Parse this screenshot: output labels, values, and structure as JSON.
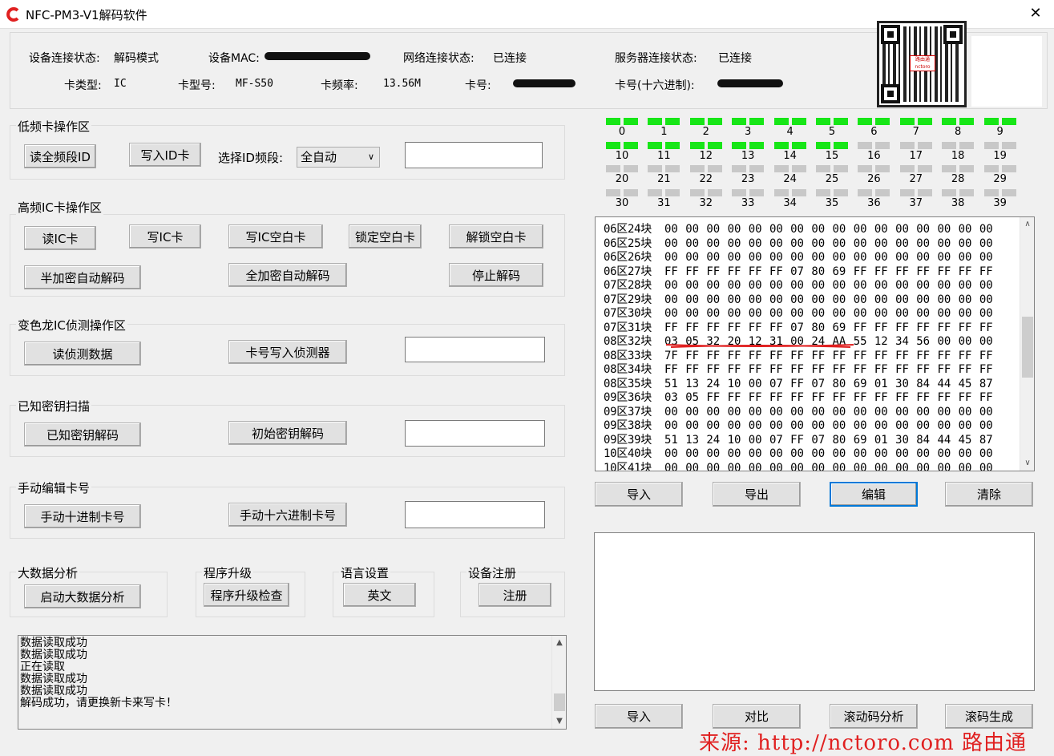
{
  "window": {
    "title": "NFC-PM3-V1解码软件",
    "close_glyph": "✕",
    "logo_color": "#e02020"
  },
  "status": {
    "device_state_label": "设备连接状态:",
    "device_state_value": "解码模式",
    "mac_label": "设备MAC:",
    "network_label": "网络连接状态:",
    "network_value": "已连接",
    "server_label": "服务器连接状态:",
    "server_value": "已连接",
    "card_type_label": "卡类型:",
    "card_type_value": "IC",
    "card_model_label": "卡型号:",
    "card_model_value": "MF-S50",
    "card_freq_label": "卡频率:",
    "card_freq_value": "13.56M",
    "card_no_label": "卡号:",
    "card_no_hex_label": "卡号(十六进制):"
  },
  "qr": {
    "badge_text": "路由通 nctoro"
  },
  "lf": {
    "title": "低频卡操作区",
    "read_all": "读全频段ID",
    "write_id": "写入ID卡",
    "select_label": "选择ID频段:",
    "select_value": "全自动"
  },
  "hf": {
    "title": "高频IC卡操作区",
    "read_ic": "读IC卡",
    "write_ic": "写IC卡",
    "write_blank": "写IC空白卡",
    "lock_blank": "锁定空白卡",
    "unlock_blank": "解锁空白卡",
    "half_decrypt": "半加密自动解码",
    "full_decrypt": "全加密自动解码",
    "stop_decrypt": "停止解码"
  },
  "chameleon": {
    "title": "变色龙IC侦测操作区",
    "read_detect": "读侦测数据",
    "write_detector": "卡号写入侦测器"
  },
  "known_keys": {
    "title": "已知密钥扫描",
    "known_decrypt": "已知密钥解码",
    "initial_decrypt": "初始密钥解码"
  },
  "manual": {
    "title": "手动编辑卡号",
    "dec_card": "手动十进制卡号",
    "hex_card": "手动十六进制卡号"
  },
  "bigdata": {
    "title": "大数据分析",
    "start": "启动大数据分析"
  },
  "upgrade": {
    "title": "程序升级",
    "check": "程序升级检查"
  },
  "language": {
    "title": "语言设置",
    "english": "英文"
  },
  "register": {
    "title": "设备注册",
    "register_btn": "注册"
  },
  "sectors": {
    "colors": {
      "ok": "#17e617",
      "empty": "#c8c8c8"
    },
    "rows": [
      {
        "labels": [
          "0",
          "1",
          "2",
          "3",
          "4",
          "5",
          "6",
          "7",
          "8",
          "9"
        ],
        "status": [
          "ok",
          "ok",
          "ok",
          "ok",
          "ok",
          "ok",
          "ok",
          "ok",
          "ok",
          "ok"
        ]
      },
      {
        "labels": [
          "10",
          "11",
          "12",
          "13",
          "14",
          "15",
          "16",
          "17",
          "18",
          "19"
        ],
        "status": [
          "ok",
          "ok",
          "ok",
          "ok",
          "ok",
          "ok",
          "empty",
          "empty",
          "empty",
          "empty"
        ]
      },
      {
        "labels": [
          "20",
          "21",
          "22",
          "23",
          "24",
          "25",
          "26",
          "27",
          "28",
          "29"
        ],
        "status": [
          "empty",
          "empty",
          "empty",
          "empty",
          "empty",
          "empty",
          "empty",
          "empty",
          "empty",
          "empty"
        ]
      },
      {
        "labels": [
          "30",
          "31",
          "32",
          "33",
          "34",
          "35",
          "36",
          "37",
          "38",
          "39"
        ],
        "status": [
          "empty",
          "empty",
          "empty",
          "empty",
          "empty",
          "empty",
          "empty",
          "empty",
          "empty",
          "empty"
        ]
      }
    ]
  },
  "hexdump": {
    "rows": [
      {
        "prefix": "06区24块",
        "bytes": [
          "00",
          "00",
          "00",
          "00",
          "00",
          "00",
          "00",
          "00",
          "00",
          "00",
          "00",
          "00",
          "00",
          "00",
          "00",
          "00"
        ]
      },
      {
        "prefix": "06区25块",
        "bytes": [
          "00",
          "00",
          "00",
          "00",
          "00",
          "00",
          "00",
          "00",
          "00",
          "00",
          "00",
          "00",
          "00",
          "00",
          "00",
          "00"
        ]
      },
      {
        "prefix": "06区26块",
        "bytes": [
          "00",
          "00",
          "00",
          "00",
          "00",
          "00",
          "00",
          "00",
          "00",
          "00",
          "00",
          "00",
          "00",
          "00",
          "00",
          "00"
        ]
      },
      {
        "prefix": "06区27块",
        "bytes": [
          "FF",
          "FF",
          "FF",
          "FF",
          "FF",
          "FF",
          "07",
          "80",
          "69",
          "FF",
          "FF",
          "FF",
          "FF",
          "FF",
          "FF",
          "FF"
        ]
      },
      {
        "prefix": "07区28块",
        "bytes": [
          "00",
          "00",
          "00",
          "00",
          "00",
          "00",
          "00",
          "00",
          "00",
          "00",
          "00",
          "00",
          "00",
          "00",
          "00",
          "00"
        ]
      },
      {
        "prefix": "07区29块",
        "bytes": [
          "00",
          "00",
          "00",
          "00",
          "00",
          "00",
          "00",
          "00",
          "00",
          "00",
          "00",
          "00",
          "00",
          "00",
          "00",
          "00"
        ]
      },
      {
        "prefix": "07区30块",
        "bytes": [
          "00",
          "00",
          "00",
          "00",
          "00",
          "00",
          "00",
          "00",
          "00",
          "00",
          "00",
          "00",
          "00",
          "00",
          "00",
          "00"
        ]
      },
      {
        "prefix": "07区31块",
        "bytes": [
          "FF",
          "FF",
          "FF",
          "FF",
          "FF",
          "FF",
          "07",
          "80",
          "69",
          "FF",
          "FF",
          "FF",
          "FF",
          "FF",
          "FF",
          "FF"
        ]
      },
      {
        "prefix": "08区32块",
        "bytes": [
          "03",
          "05",
          "32",
          "20",
          "12",
          "31",
          "00",
          "24",
          "AA",
          "55",
          "12",
          "34",
          "56",
          "00",
          "00",
          "00"
        ]
      },
      {
        "prefix": "08区33块",
        "bytes": [
          "7F",
          "FF",
          "FF",
          "FF",
          "FF",
          "FF",
          "FF",
          "FF",
          "FF",
          "FF",
          "FF",
          "FF",
          "FF",
          "FF",
          "FF",
          "FF"
        ]
      },
      {
        "prefix": "08区34块",
        "bytes": [
          "FF",
          "FF",
          "FF",
          "FF",
          "FF",
          "FF",
          "FF",
          "FF",
          "FF",
          "FF",
          "FF",
          "FF",
          "FF",
          "FF",
          "FF",
          "FF"
        ]
      },
      {
        "prefix": "08区35块",
        "bytes": [
          "51",
          "13",
          "24",
          "10",
          "00",
          "07",
          "FF",
          "07",
          "80",
          "69",
          "01",
          "30",
          "84",
          "44",
          "45",
          "87"
        ]
      },
      {
        "prefix": "09区36块",
        "bytes": [
          "03",
          "05",
          "FF",
          "FF",
          "FF",
          "FF",
          "FF",
          "FF",
          "FF",
          "FF",
          "FF",
          "FF",
          "FF",
          "FF",
          "FF",
          "FF"
        ]
      },
      {
        "prefix": "09区37块",
        "bytes": [
          "00",
          "00",
          "00",
          "00",
          "00",
          "00",
          "00",
          "00",
          "00",
          "00",
          "00",
          "00",
          "00",
          "00",
          "00",
          "00"
        ]
      },
      {
        "prefix": "09区38块",
        "bytes": [
          "00",
          "00",
          "00",
          "00",
          "00",
          "00",
          "00",
          "00",
          "00",
          "00",
          "00",
          "00",
          "00",
          "00",
          "00",
          "00"
        ]
      },
      {
        "prefix": "09区39块",
        "bytes": [
          "51",
          "13",
          "24",
          "10",
          "00",
          "07",
          "FF",
          "07",
          "80",
          "69",
          "01",
          "30",
          "84",
          "44",
          "45",
          "87"
        ]
      },
      {
        "prefix": "10区40块",
        "bytes": [
          "00",
          "00",
          "00",
          "00",
          "00",
          "00",
          "00",
          "00",
          "00",
          "00",
          "00",
          "00",
          "00",
          "00",
          "00",
          "00"
        ]
      },
      {
        "prefix": "10区41块",
        "bytes": [
          "00",
          "00",
          "00",
          "00",
          "00",
          "00",
          "00",
          "00",
          "00",
          "00",
          "00",
          "00",
          "00",
          "00",
          "00",
          "00"
        ]
      }
    ],
    "annotation_color": "#e02020"
  },
  "data_buttons": {
    "import": "导入",
    "export": "导出",
    "edit": "编辑",
    "clear": "清除"
  },
  "log": {
    "lines": [
      "数据读取成功",
      "数据读取成功",
      "正在读取",
      "数据读取成功",
      "数据读取成功",
      "解码成功，请更换新卡来写卡！"
    ]
  },
  "bottom_buttons": {
    "import": "导入",
    "compare": "对比",
    "rolling_analysis": "滚动码分析",
    "rolling_generate": "滚码生成"
  },
  "watermark": {
    "text": "来源: http://nctoro.com 路由通"
  }
}
